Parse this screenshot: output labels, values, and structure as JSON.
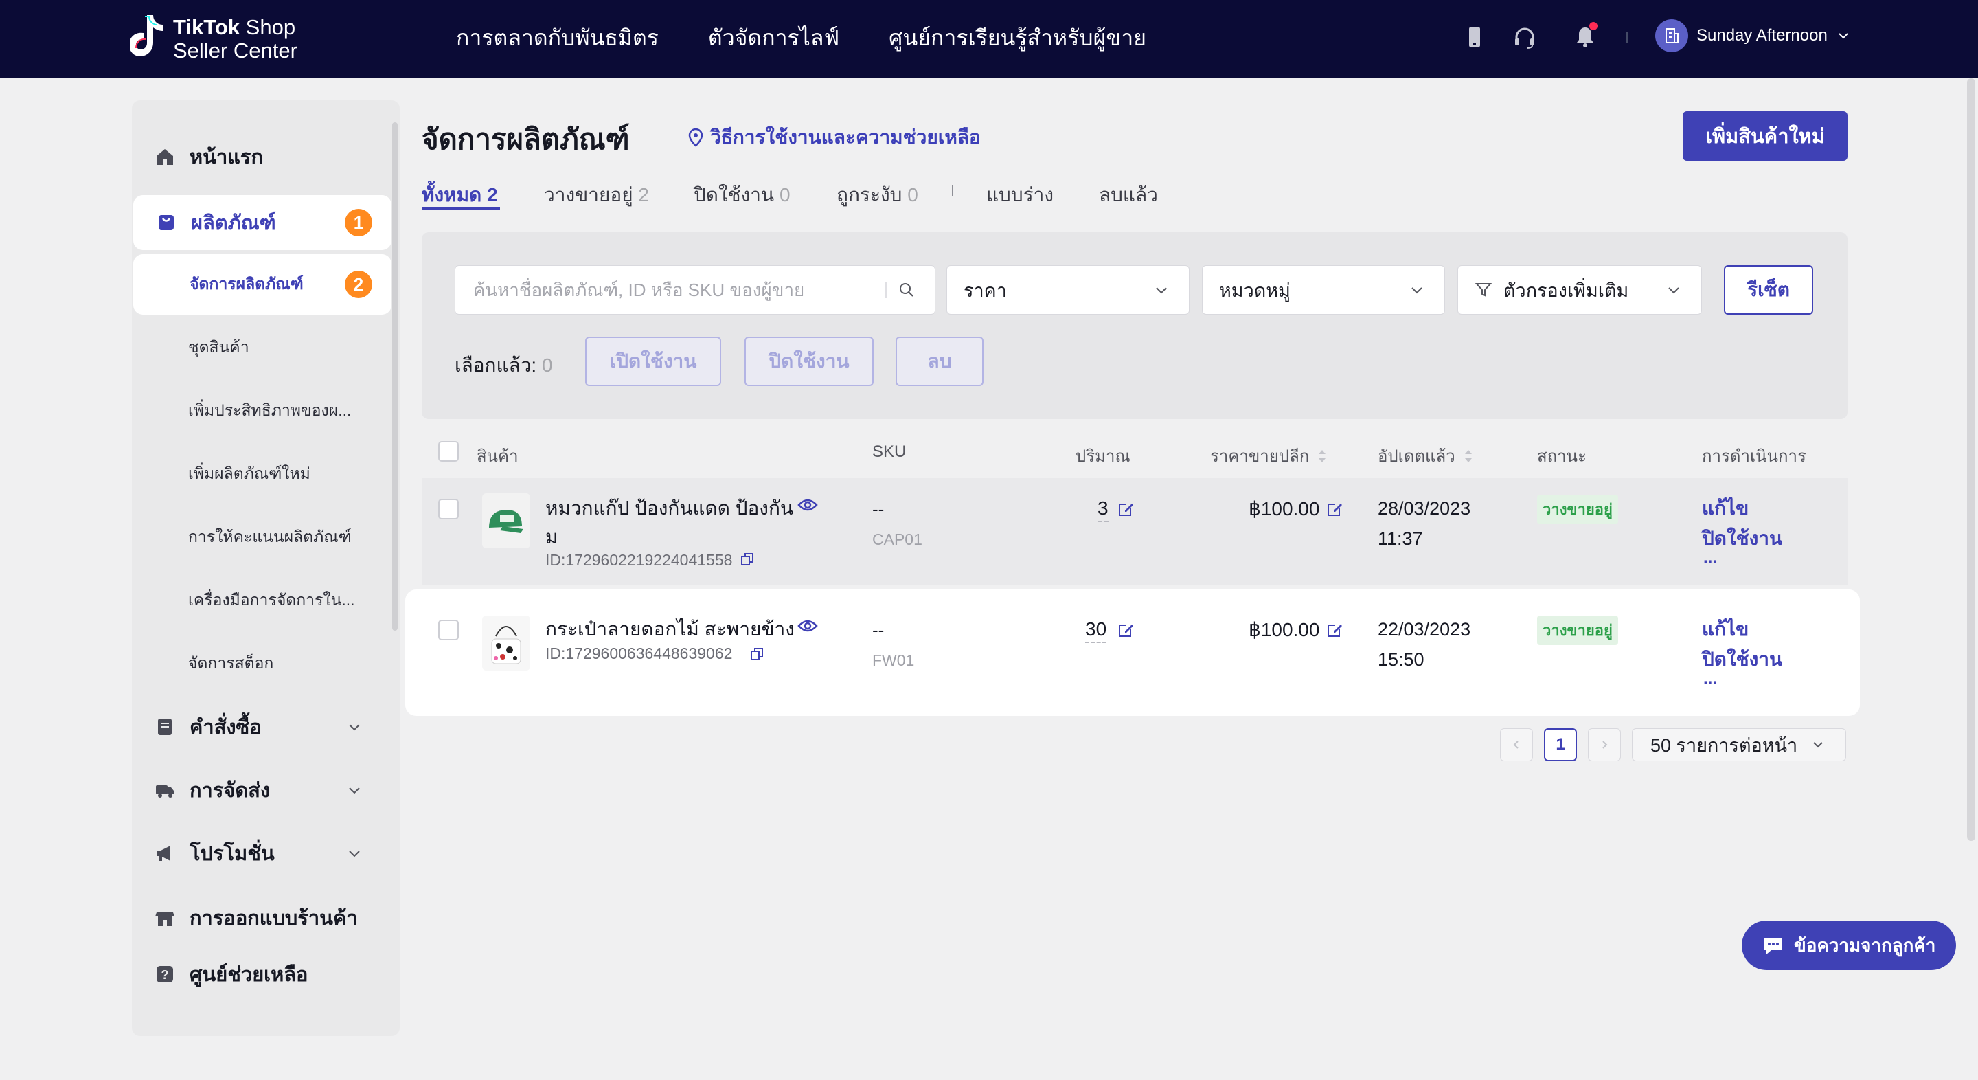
{
  "brand": {
    "line1_bold": "TikTok",
    "line1_rest": " Shop",
    "line2": "Seller Center"
  },
  "topnav": {
    "links": [
      "การตลาดกับพันธมิตร",
      "ตัวจัดการไลฟ์",
      "ศูนย์การเรียนรู้สำหรับผู้ขาย"
    ],
    "user_name": "Sunday Afternoon"
  },
  "sidebar": {
    "home": "หน้าแรก",
    "products": "ผลิตภัณฑ์",
    "products_badge": "1",
    "sub_items": [
      "จัดการผลิตภัณฑ์",
      "ชุดสินค้า",
      "เพิ่มประสิทธิภาพของผ...",
      "เพิ่มผลิตภัณฑ์ใหม่",
      "การให้คะแนนผลิตภัณฑ์",
      "เครื่องมือการจัดการใน...",
      "จัดการสต็อก"
    ],
    "manage_badge": "2",
    "orders": "คำสั่งซื้อ",
    "shipping": "การจัดส่ง",
    "promotions": "โปรโมชั่น",
    "shop_design": "การออกแบบร้านค้า",
    "help_center": "ศูนย์ช่วยเหลือ"
  },
  "main": {
    "title": "จัดการผลิตภัณฑ์",
    "help_link": "วิธีการใช้งานและความช่วยเหลือ",
    "add_button": "เพิ่มสินค้าใหม่",
    "tabs": [
      {
        "label": "ทั้งหมด",
        "count": "2"
      },
      {
        "label": "วางขายอยู่",
        "count": "2"
      },
      {
        "label": "ปิดใช้งาน",
        "count": "0"
      },
      {
        "label": "ถูกระงับ",
        "count": "0"
      },
      {
        "label": "แบบร่าง",
        "count": ""
      },
      {
        "label": "ลบแล้ว",
        "count": ""
      }
    ]
  },
  "filters": {
    "search_placeholder": "ค้นหาชื่อผลิตภัณฑ์, ID หรือ SKU ของผู้ขาย",
    "price": "ราคา",
    "category": "หมวดหมู่",
    "more_filters": "ตัวกรองเพิ่มเติม",
    "reset": "รีเซ็ต",
    "selected_label": "เลือกแล้ว:",
    "selected_count": "0",
    "enable": "เปิดใช้งาน",
    "disable": "ปิดใช้งาน",
    "delete": "ลบ"
  },
  "table": {
    "headers": {
      "product": "สินค้า",
      "sku": "SKU",
      "qty": "ปริมาณ",
      "price": "ราคาขายปลีก",
      "updated": "อัปเดตแล้ว",
      "status": "สถานะ",
      "actions": "การดำเนินการ"
    },
    "rows": [
      {
        "name1": "หมวกแก๊ป ป้องกันแดด ป้องกัน",
        "name2": "ม",
        "id": "ID:1729602219224041558",
        "sku": "--",
        "sku2": "CAP01",
        "qty": "3",
        "price": "฿100.00",
        "date": "28/03/2023",
        "time": "11:37",
        "status": "วางขายอยู่",
        "edit": "แก้ไข",
        "disable": "ปิดใช้งาน",
        "more": "..."
      },
      {
        "name1": "กระเป๋าลายดอกไม้ สะพายข้าง",
        "name2": "",
        "id": "ID:1729600636448639062",
        "sku": "--",
        "sku2": "FW01",
        "qty": "30",
        "price": "฿100.00",
        "date": "22/03/2023",
        "time": "15:50",
        "status": "วางขายอยู่",
        "edit": "แก้ไข",
        "disable": "ปิดใช้งาน",
        "more": "..."
      }
    ]
  },
  "pagination": {
    "current": "1",
    "page_size": "50 รายการต่อหน้า"
  },
  "chat": {
    "label": "ข้อความจากลูกค้า"
  },
  "colors": {
    "nav": "#0b0b36",
    "accent": "#3f41b5",
    "badge": "#ff8a1f",
    "status_green": "#2ca04a"
  }
}
